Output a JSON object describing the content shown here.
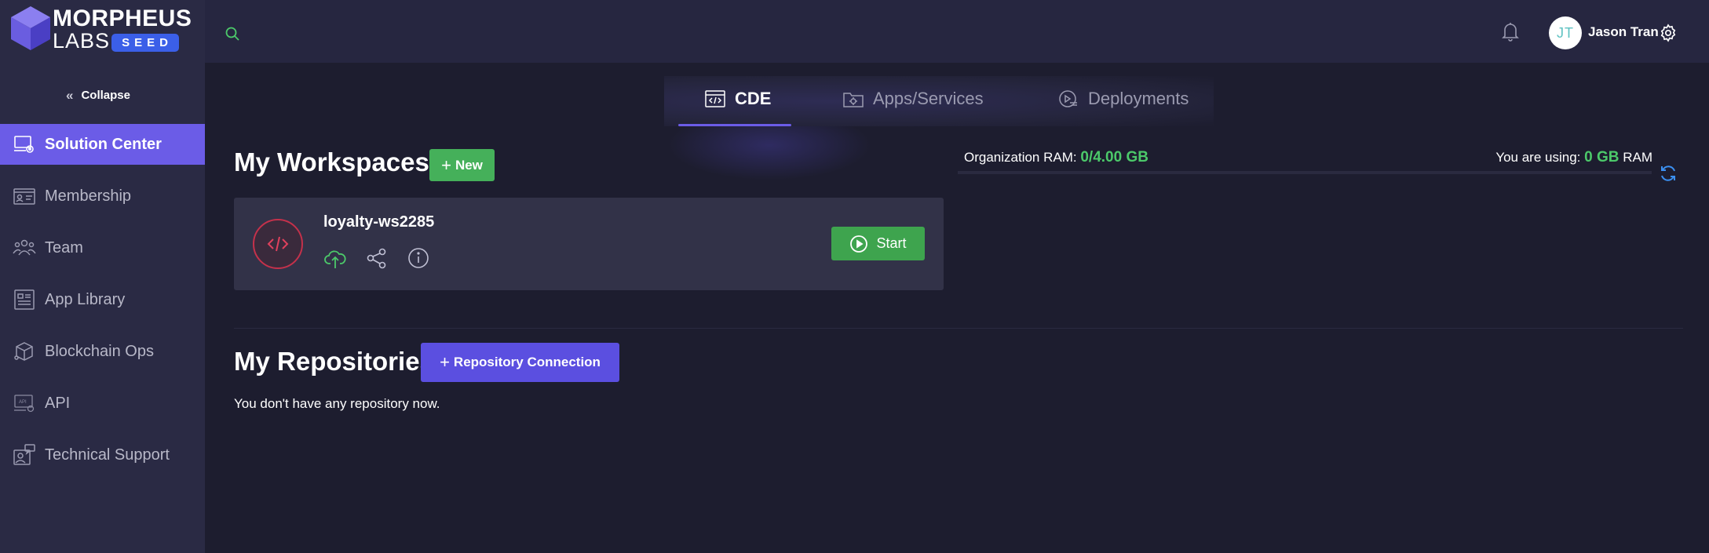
{
  "brand": {
    "name_top": "MORPHEUS",
    "name_bottom": "LABS",
    "badge": "SEED",
    "colors": {
      "accent": "#6b5ce7",
      "cube_light": "#8b7ff0",
      "cube_dark": "#4a3fc4",
      "badge_bg": "#3b5fe8"
    }
  },
  "sidebar": {
    "collapse_label": "Collapse",
    "items": [
      {
        "label": "Solution Center",
        "icon": "solution-center-icon",
        "active": true
      },
      {
        "label": "Membership",
        "icon": "membership-card-icon",
        "active": false
      },
      {
        "label": "Team",
        "icon": "team-icon",
        "active": false
      },
      {
        "label": "App Library",
        "icon": "app-library-icon",
        "active": false
      },
      {
        "label": "Blockchain Ops",
        "icon": "blockchain-cube-icon",
        "active": false
      },
      {
        "label": "API",
        "icon": "api-icon",
        "active": false
      },
      {
        "label": "Technical Support",
        "icon": "technical-support-icon",
        "active": false
      }
    ]
  },
  "header": {
    "search_icon": "search-icon",
    "notification_icon": "bell-icon",
    "user": {
      "initials": "JT",
      "name": "Jason Tran"
    },
    "settings_icon": "gear-icon"
  },
  "tabs": [
    {
      "label": "CDE",
      "icon": "code-window-icon",
      "active": true
    },
    {
      "label": "Apps/Services",
      "icon": "apps-services-icon",
      "active": false
    },
    {
      "label": "Deployments",
      "icon": "deployments-icon",
      "active": false
    }
  ],
  "workspaces": {
    "title": "My Workspaces",
    "new_label": "New",
    "items": [
      {
        "name": "loyalty-ws2285",
        "icon": "code-icon",
        "actions": [
          "cloud-upload-icon",
          "share-icon",
          "info-icon"
        ],
        "start_label": "Start"
      }
    ]
  },
  "ram": {
    "org_label": "Organization RAM:",
    "org_value": "0/4.00 GB",
    "using_label": "You are using:",
    "using_value": "0 GB",
    "using_unit": "RAM",
    "refresh_icon": "refresh-icon"
  },
  "repositories": {
    "title": "My Repositories",
    "connect_label": "Repository Connection",
    "empty_text": "You don't have any repository now."
  }
}
